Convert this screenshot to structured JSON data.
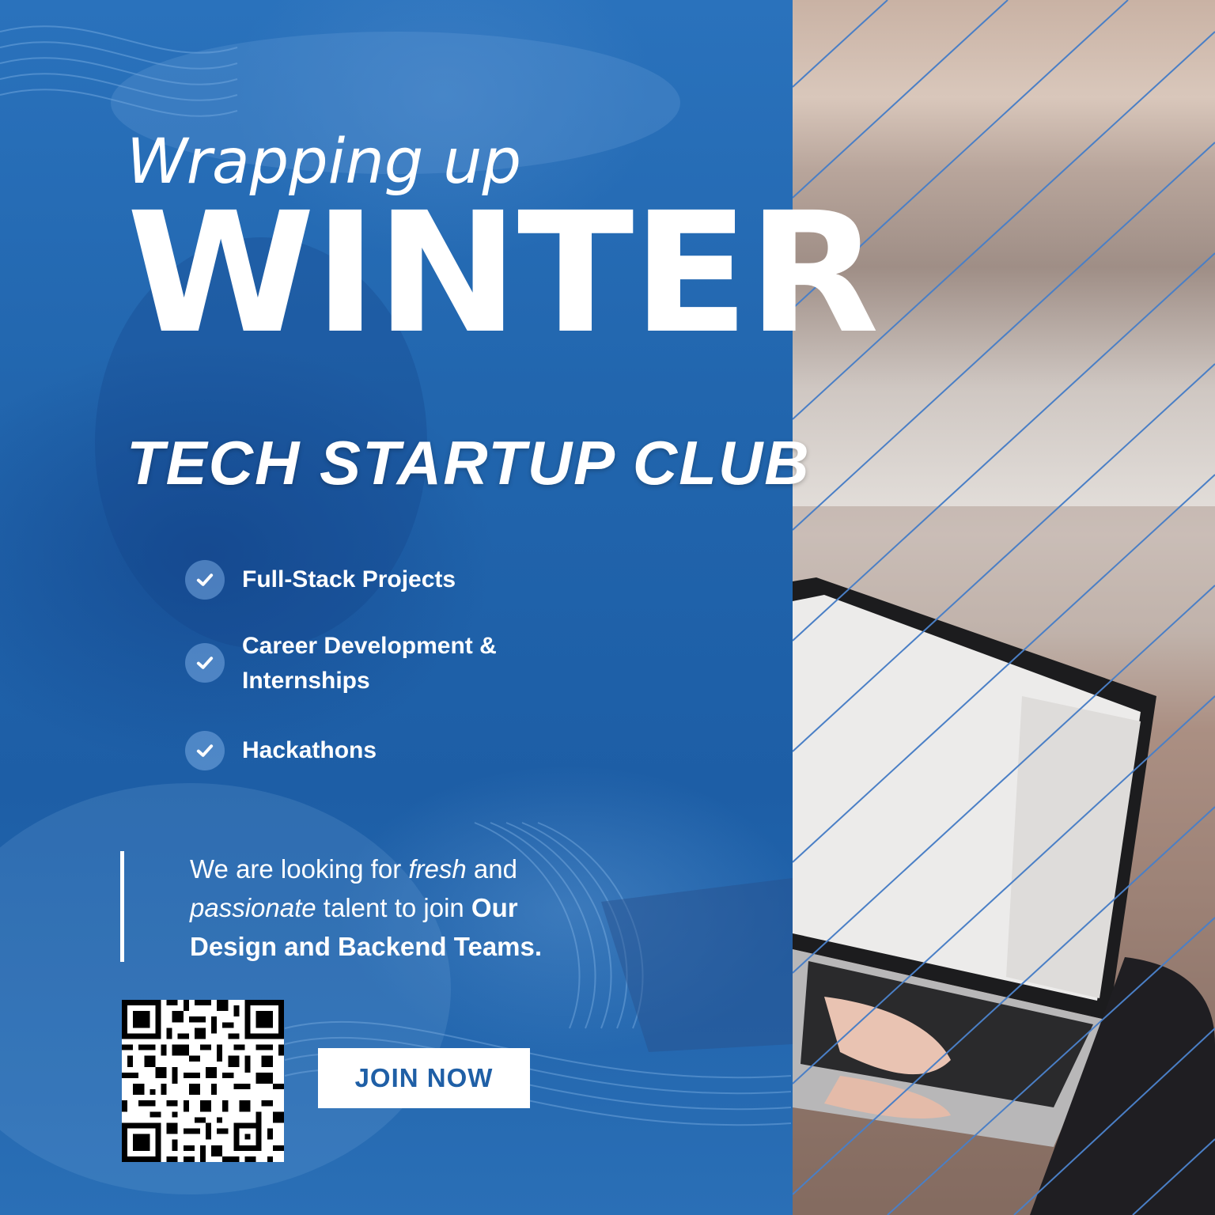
{
  "headline": {
    "kicker": "Wrapping up",
    "title": "WINTER",
    "club": "TECH STARTUP CLUB"
  },
  "features": [
    {
      "icon": "check-icon",
      "lines": [
        "Full-Stack Projects"
      ]
    },
    {
      "icon": "check-icon",
      "lines": [
        "Career Development &",
        "Internships"
      ]
    },
    {
      "icon": "check-icon",
      "lines": [
        "Hackathons"
      ]
    }
  ],
  "description": {
    "part1": "We are looking for ",
    "fresh": "fresh",
    "part2": " and ",
    "passionate": "passionate",
    "part3": " talent to join ",
    "teams": "Our Design and Backend Teams."
  },
  "cta": {
    "label": "JOIN NOW"
  },
  "colors": {
    "primary_blue": "#1e5fa5",
    "text": "#ffffff",
    "button_text": "#1f5fa6"
  }
}
